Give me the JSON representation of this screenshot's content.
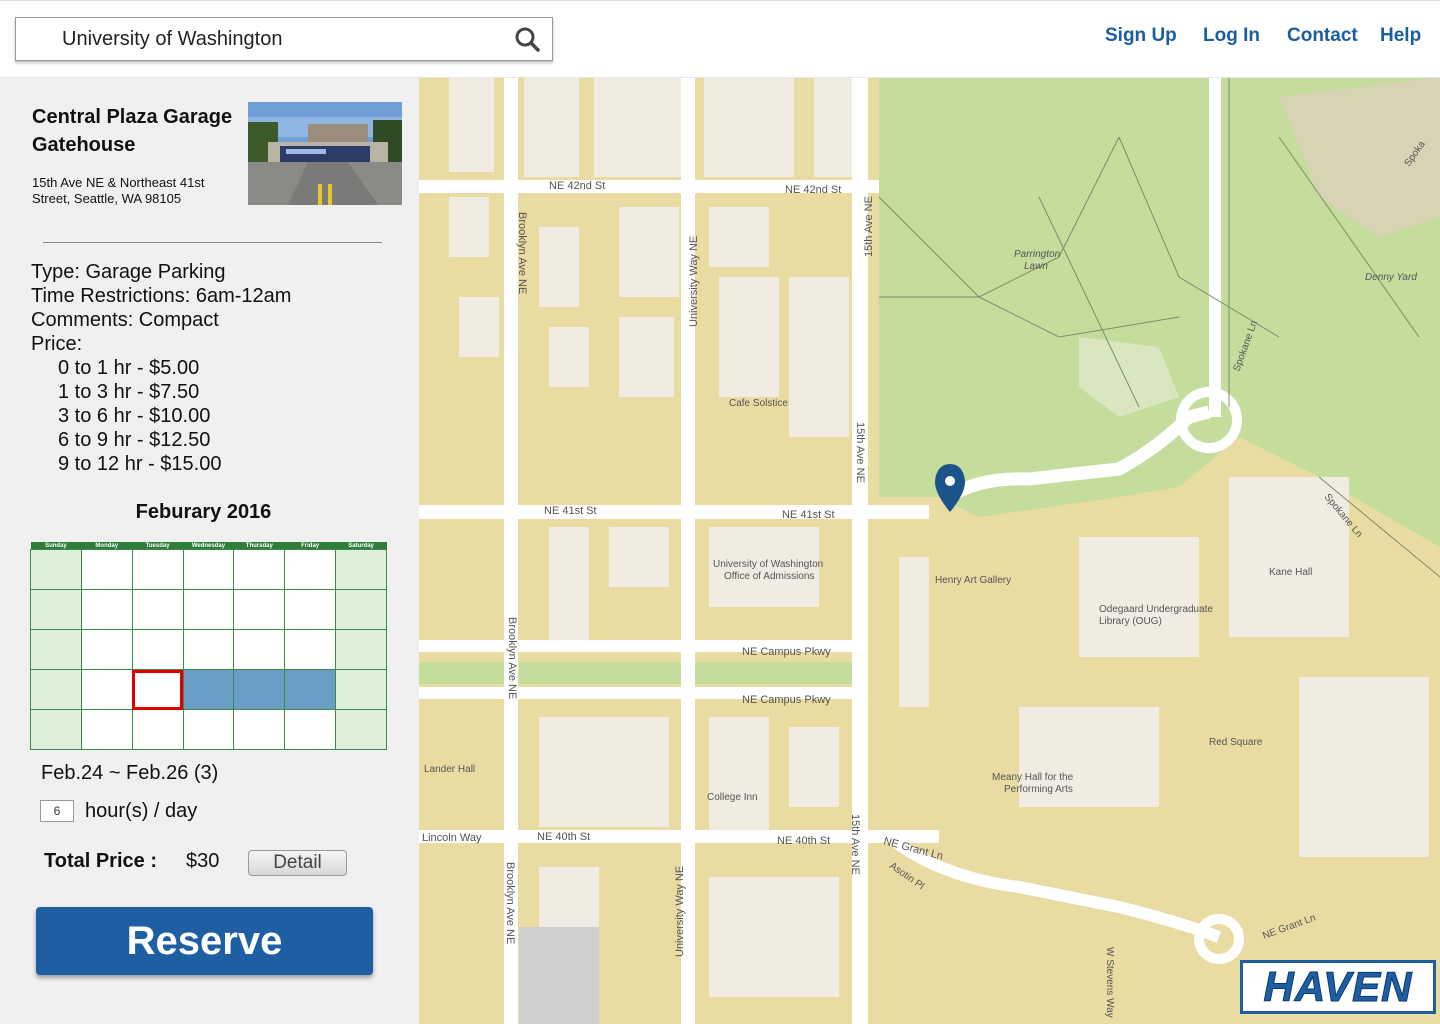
{
  "search": {
    "value": "University of Washington",
    "icon": "search-icon"
  },
  "nav": {
    "sign_up": "Sign Up",
    "log_in": "Log In",
    "contact": "Contact",
    "help": "Help"
  },
  "colors": {
    "brand": "#1e5fa3",
    "nav": "#1b5e9e",
    "calendar_header": "#2e7d3a",
    "selected_day": "#6a9ec7",
    "today_outline": "#e00000"
  },
  "lot": {
    "name_line1": "Central Plaza Garage",
    "name_line2": "Gatehouse",
    "address_line1": "15th Ave NE & Northeast 41st",
    "address_line2": "Street, Seattle, WA 98105",
    "type": "Type: Garage Parking",
    "time": "Time Restrictions: 6am-12am",
    "comments": "Comments: Compact",
    "price_heading": "Price:",
    "prices": [
      "0 to 1 hr - $5.00",
      "1 to 3 hr - $7.50",
      "3 to 6 hr - $10.00",
      "6 to 9 hr - $12.50",
      "9 to 12 hr - $15.00"
    ]
  },
  "calendar": {
    "title": "Feburary 2016",
    "days": [
      "Sunday",
      "Monday",
      "Tuesday",
      "Wednesday",
      "Thursday",
      "Friday",
      "Saturday"
    ]
  },
  "booking": {
    "range": "Feb.24 ~ Feb.26 (3)",
    "hours": "6",
    "hours_label": "hour(s) / day",
    "total_label": "Total Price :",
    "total_value": "$30",
    "detail": "Detail",
    "reserve": "Reserve"
  },
  "map": {
    "labels": {
      "ne42_a": "NE 42nd St",
      "ne42_b": "NE 42nd St",
      "ne41_a": "NE 41st St",
      "ne41_b": "NE 41st St",
      "ne40_a": "NE 40th St",
      "ne40_b": "NE 40th St",
      "campus1": "NE Campus Pkwy",
      "campus2": "NE Campus Pkwy",
      "brooklyn1": "Brooklyn Ave NE",
      "brooklyn2": "Brooklyn Ave NE",
      "brooklyn3": "Brooklyn Ave NE",
      "univway1": "University Way NE",
      "univway2": "University Way NE",
      "ave15_1": "15th Ave NE",
      "ave15_2": "15th Ave NE",
      "ave15_3": "15th Ave NE",
      "cafe": "Cafe Solstice",
      "admissions1": "University of Washington",
      "admissions2": "Office of Admissions",
      "henry": "Henry Art Gallery",
      "odegaard1": "Odegaard Undergraduate",
      "odegaard2": "Library (OUG)",
      "kane": "Kane Hall",
      "red_square": "Red Square",
      "meany1": "Meany Hall for the",
      "meany2": "Performing Arts",
      "lander": "Lander Hall",
      "college_inn": "College Inn",
      "lincoln": "Lincoln Way",
      "grant1": "NE Grant Ln",
      "grant2": "NE Grant Ln",
      "asotin": "Asotin Pl",
      "stevens": "W Stevens Way",
      "parrington1": "Parrington",
      "parrington2": "Lawn",
      "denny": "Denny Yard",
      "spokane1": "Spokane Ln",
      "spokane2": "Spokane Ln",
      "spokane3": "Spoka"
    }
  },
  "logo": "HAVEN"
}
